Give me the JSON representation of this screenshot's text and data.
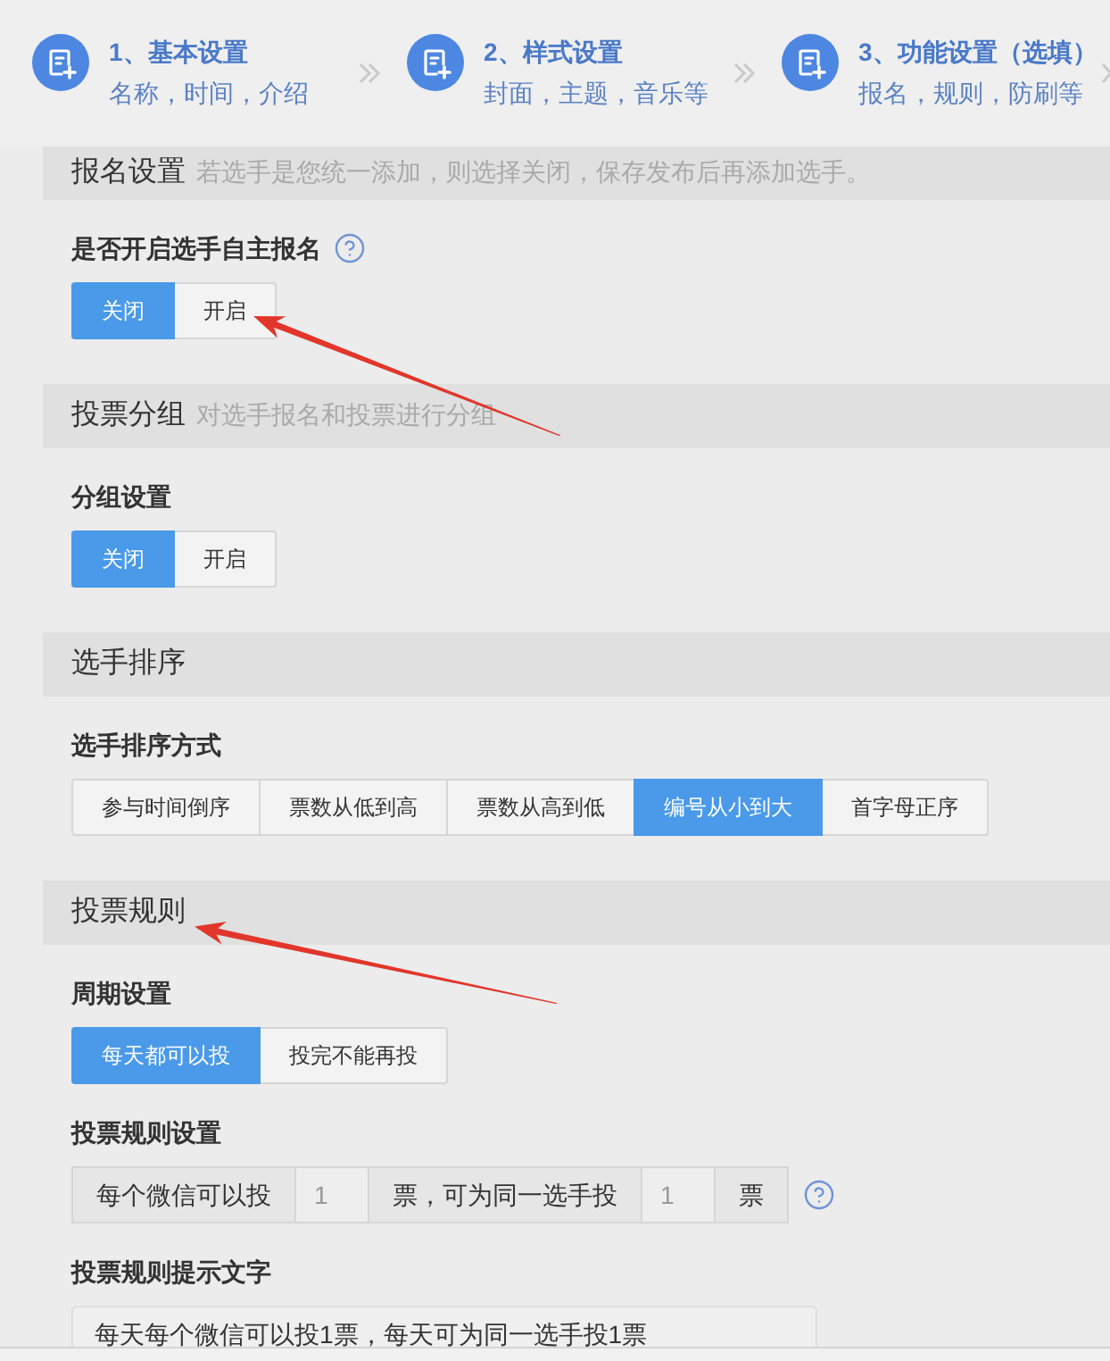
{
  "steps": [
    {
      "title": "1、基本设置",
      "subtitle": "名称，时间，介绍"
    },
    {
      "title": "2、样式设置",
      "subtitle": "封面，主题，音乐等"
    },
    {
      "title": "3、功能设置（选填）",
      "subtitle": "报名，规则，防刷等"
    }
  ],
  "sections": [
    {
      "title": "报名设置",
      "description": "若选手是您统一添加，则选择关闭，保存发布后再添加选手。",
      "fields": [
        {
          "kind": "toggle",
          "label": "是否开启选手自主报名",
          "help": true,
          "options": [
            {
              "label": "关闭",
              "selected": true
            },
            {
              "label": "开启",
              "selected": false
            }
          ]
        }
      ]
    },
    {
      "title": "投票分组",
      "description": "对选手报名和投票进行分组",
      "fields": [
        {
          "kind": "toggle",
          "label": "分组设置",
          "options": [
            {
              "label": "关闭",
              "selected": true
            },
            {
              "label": "开启",
              "selected": false
            }
          ]
        }
      ]
    },
    {
      "title": "选手排序",
      "fields": [
        {
          "kind": "toggle",
          "label": "选手排序方式",
          "options": [
            {
              "label": "参与时间倒序",
              "selected": false
            },
            {
              "label": "票数从低到高",
              "selected": false
            },
            {
              "label": "票数从高到低",
              "selected": false
            },
            {
              "label": "编号从小到大",
              "selected": true
            },
            {
              "label": "首字母正序",
              "selected": false
            }
          ]
        }
      ]
    },
    {
      "title": "投票规则",
      "fields": [
        {
          "kind": "toggle",
          "label": "周期设置",
          "options": [
            {
              "label": "每天都可以投",
              "selected": true
            },
            {
              "label": "投完不能再投",
              "selected": false
            }
          ]
        },
        {
          "kind": "input_group",
          "label": "投票规则设置",
          "help": true,
          "parts": [
            {
              "kind": "addon",
              "text": "每个微信可以投"
            },
            {
              "kind": "input",
              "placeholder": "1"
            },
            {
              "kind": "addon",
              "text": "票，可为同一选手投"
            },
            {
              "kind": "input",
              "placeholder": "1"
            },
            {
              "kind": "addon",
              "text": "票"
            }
          ]
        },
        {
          "kind": "textarea",
          "label": "投票规则提示文字",
          "value": "每天每个微信可以投1票，每天可为同一选手投1票"
        }
      ]
    }
  ]
}
